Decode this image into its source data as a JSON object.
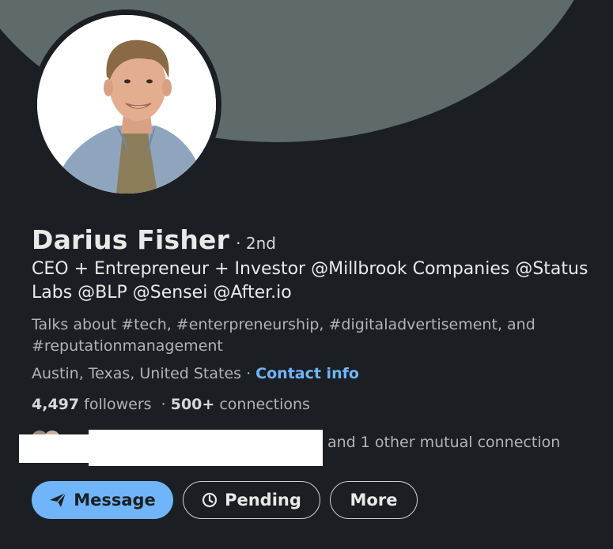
{
  "profile": {
    "name": "Darius Fisher",
    "degree": "· 2nd",
    "headline": "CEO + Entrepreneur + Investor @Millbrook Companies @Status Labs @BLP @Sensei @After.io",
    "talks_about": "Talks about #tech, #enterpreneurship, #digitaladvertisement, and #reputationmanagement",
    "location": "Austin, Texas, United States",
    "location_sep": " · ",
    "contact_info": "Contact info",
    "followers_count": "4,497",
    "followers_label": " followers",
    "stats_sep": " · ",
    "connections_count": "500+",
    "connections_label": " connections",
    "mutual_text": "and 1 other mutual connection"
  },
  "actions": {
    "message": "Message",
    "pending": "Pending",
    "more": "More"
  },
  "colors": {
    "background": "#1b1f23",
    "banner": "#5f6b6b",
    "accent": "#70b5f9",
    "text_primary": "#e9e9e9",
    "text_secondary": "#b3b3b3"
  },
  "icons": {
    "message": "send-icon",
    "pending": "clock-icon"
  }
}
